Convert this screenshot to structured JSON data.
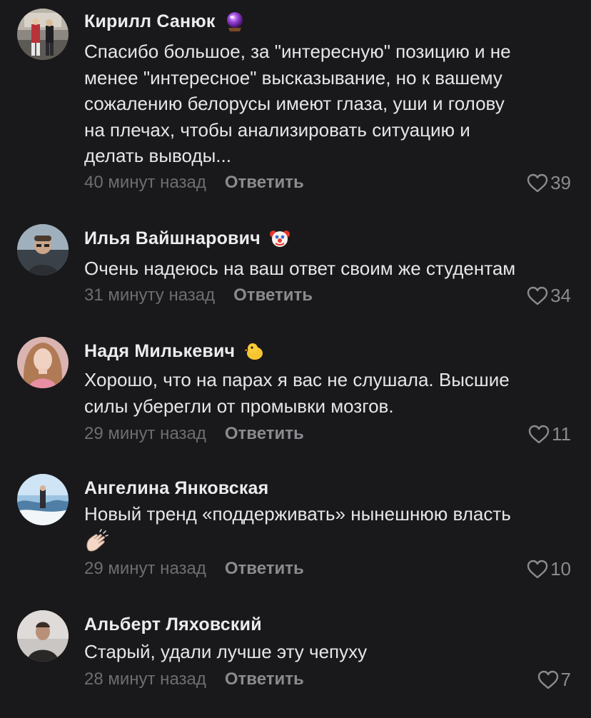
{
  "colors": {
    "background": "#19191b",
    "name": "#ececee",
    "text": "#e6e6e8",
    "time": "#6d6d72",
    "action": "#8a8a8f"
  },
  "reply_label": "Ответить",
  "comments": [
    {
      "author": "Кирилл Санюк",
      "author_emoji": "crystal-ball",
      "text_lines": [
        "Спасибо большое, за \"интересную\" позицию и не",
        "менее \"интересное\" высказывание, но к вашему",
        "сожалению белорусы имеют глаза, уши и голову",
        "на плечах, чтобы анализировать ситуацию и",
        "делать выводы..."
      ],
      "time": "40 минут назад",
      "likes": "39"
    },
    {
      "author": "Илья Вайшнарович",
      "author_emoji": "clown-face",
      "text_lines": [
        "Очень надеюсь на ваш ответ своим же студентам"
      ],
      "time": "31 минуту назад",
      "likes": "34"
    },
    {
      "author": "Надя Милькевич",
      "author_emoji": "baby-chick",
      "text_lines": [
        "Хорошо, что на парах я вас не слушала. Высшие",
        "силы уберегли от промывки мозгов."
      ],
      "time": "29 минут назад",
      "likes": "11"
    },
    {
      "author": "Ангелина Янковская",
      "author_emoji": "",
      "text_lines": [
        "Новый тренд «поддерживать» нынешнюю власть"
      ],
      "text_emoji": "clapping-hands",
      "time": "29 минут назад",
      "likes": "10"
    },
    {
      "author": "Альберт Ляховский",
      "author_emoji": "",
      "text_lines": [
        "Старый, удали лучше эту чепуху"
      ],
      "time": "28 минут назад",
      "likes": "7"
    }
  ]
}
